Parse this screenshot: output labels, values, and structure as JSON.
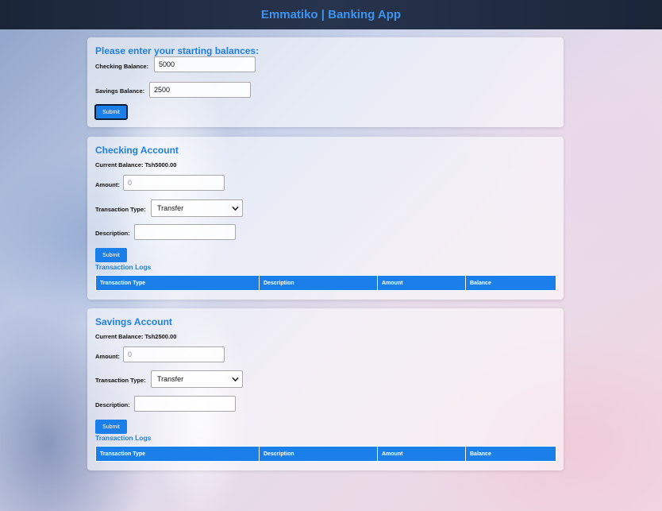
{
  "header": {
    "title": "Emmatiko | Banking App"
  },
  "setup": {
    "heading": "Please enter your starting balances:",
    "checking_label": "Checking Balance:",
    "checking_value": "5000",
    "savings_label": "Savings Balance:",
    "savings_value": "2500",
    "submit_label": "Submit"
  },
  "checking": {
    "heading": "Checking Account",
    "current_balance": "Current Balance: Tsh5000.00",
    "amount_label": "Amount:",
    "amount_value": "0",
    "type_label": "Transaction Type:",
    "type_value": "Transfer",
    "description_label": "Description:",
    "description_value": "",
    "submit_label": "Submit",
    "logs_title": "Transaction Logs",
    "columns": [
      "Transaction Type",
      "Description",
      "Amount",
      "Balance"
    ]
  },
  "savings": {
    "heading": "Savings Account",
    "current_balance": "Current Balance: Tsh2500.00",
    "amount_label": "Amount:",
    "amount_value": "0",
    "type_label": "Transaction Type:",
    "type_value": "Transfer",
    "description_label": "Description:",
    "description_value": "",
    "submit_label": "Submit",
    "logs_title": "Transaction Logs",
    "columns": [
      "Transaction Type",
      "Description",
      "Amount",
      "Balance"
    ]
  },
  "icons": {
    "select_arrow": "chevron-down-icon"
  },
  "colors": {
    "accent": "#1a7fe8",
    "heading": "#1f7fe0",
    "header_bg": "#1b2538",
    "header_text": "#3d95f0"
  }
}
